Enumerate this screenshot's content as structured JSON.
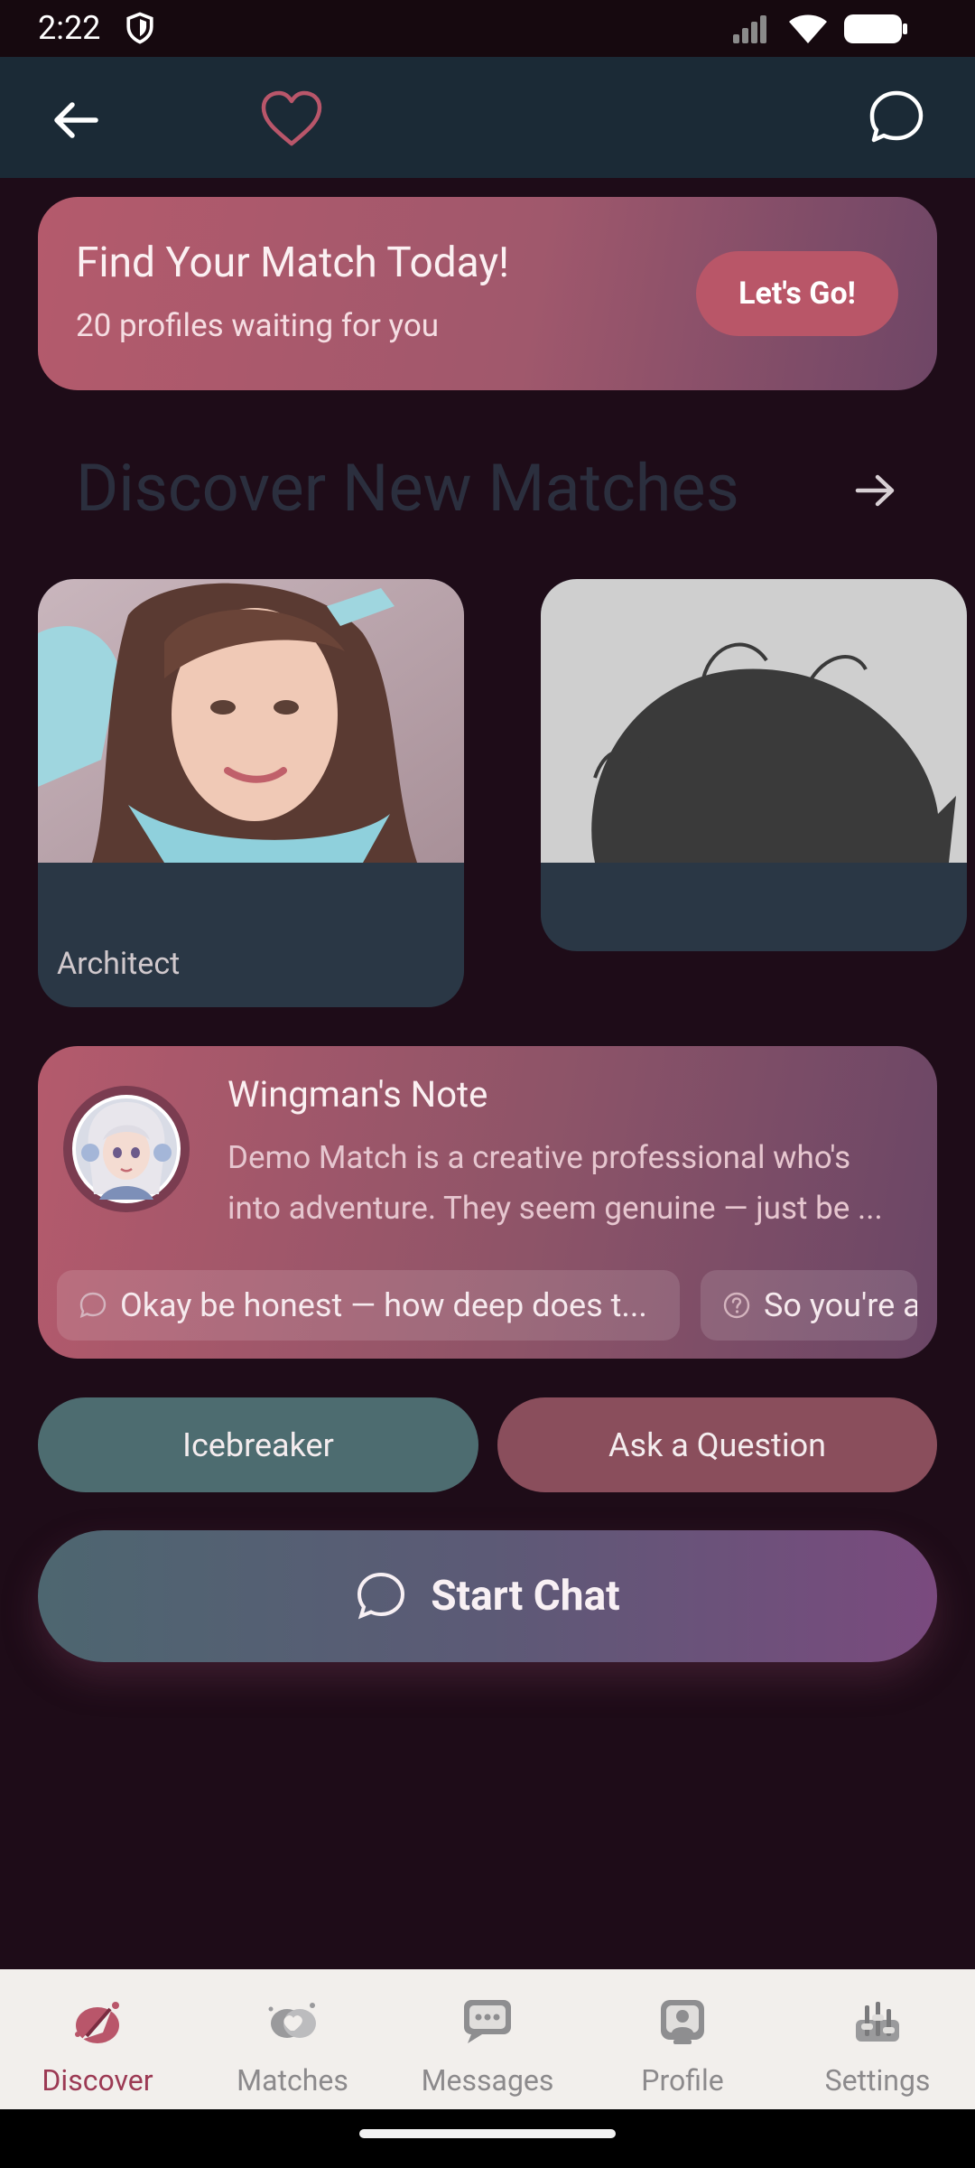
{
  "status_bar": {
    "time": "2:22"
  },
  "app_bar": {
    "icons": [
      "back-arrow-icon",
      "heart-icon",
      "chat-bubble-icon"
    ]
  },
  "promo": {
    "title": "Find Your Match Today!",
    "subtitle": "20 profiles waiting for you",
    "button_label": "Let's Go!"
  },
  "discover": {
    "title": "Discover New Matches",
    "cards": [
      {
        "job": "Architect"
      },
      {
        "job": ""
      }
    ]
  },
  "wingman": {
    "title": "Wingman's Note",
    "text_line_1": "Demo Match is a creative professional who's",
    "text_line_2": "into adventure. They seem genuine — just be ...",
    "chips": [
      {
        "label": "Okay be honest — how deep does t...",
        "icon": "speech-bubble-icon"
      },
      {
        "label": "So you're a",
        "icon": "question-circle-icon"
      }
    ]
  },
  "actions": {
    "icebreaker_label": "Icebreaker",
    "ask_label": "Ask a Question",
    "start_chat_label": "Start Chat"
  },
  "bottom_nav": {
    "items": [
      {
        "label": "Discover",
        "icon": "compass-heart-icon",
        "active": true
      },
      {
        "label": "Matches",
        "icon": "hearts-icon",
        "active": false
      },
      {
        "label": "Messages",
        "icon": "messages-icon",
        "active": false
      },
      {
        "label": "Profile",
        "icon": "profile-icon",
        "active": false
      },
      {
        "label": "Settings",
        "icon": "sliders-icon",
        "active": false
      }
    ]
  },
  "colors": {
    "background": "#1e0c18",
    "app_bar": "#1b2a36",
    "accent": "#b95668",
    "teal_button": "#4d6c70",
    "rose_button": "#8a4e5c",
    "active_nav": "#9c3a54"
  }
}
